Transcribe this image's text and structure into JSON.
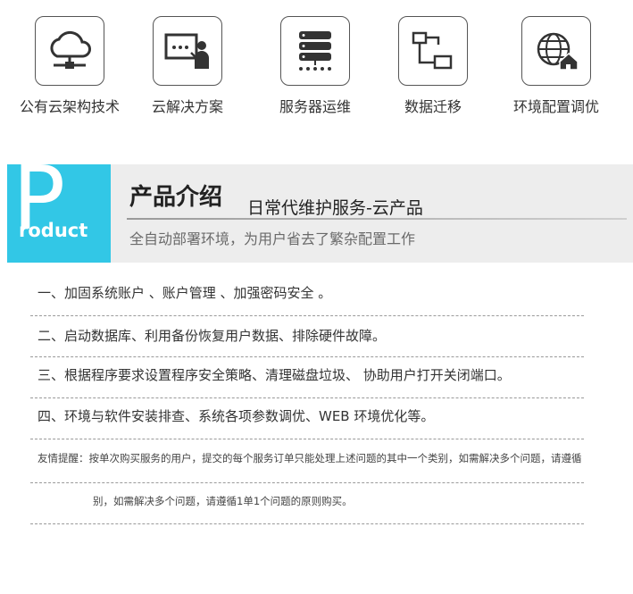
{
  "services": [
    {
      "label": "公有云架构技术",
      "icon": "cloud-network-icon"
    },
    {
      "label": "云解决方案",
      "icon": "presenter-board-icon"
    },
    {
      "label": "服务器运维",
      "icon": "server-rack-icon"
    },
    {
      "label": "数据迁移",
      "icon": "data-migration-icon"
    },
    {
      "label": "环境配置调优",
      "icon": "globe-home-icon"
    }
  ],
  "banner": {
    "logo_big": "P",
    "logo_rest": "roduct",
    "title": "产品介绍",
    "subtitle": "日常代维护服务-云产品",
    "description": "全自动部署环境，为用户省去了繁杂配置工作"
  },
  "features": [
    "一、加固系统账户 、账户管理 、加强密码安全 。",
    "二、启动数据库、利用备份恢复用户数据、排除硬件故障。",
    "三、根据程序要求设置程序安全策略、清理磁盘垃圾、 协助用户打开关闭端口。",
    "四、环境与软件安装排查、系统各项参数调优、WEB 环境优化等。"
  ],
  "notice": {
    "line1": "友情提醒：按单次购买服务的用户，提交的每个服务订单只能处理上述问题的其中一个类别，如需解决多个问题，请遵循",
    "line2": "别，如需解决多个问题，请遵循1单1个问题的原则购买。"
  },
  "colors": {
    "accent": "#32c7e6",
    "banner_bg": "#ededed"
  }
}
